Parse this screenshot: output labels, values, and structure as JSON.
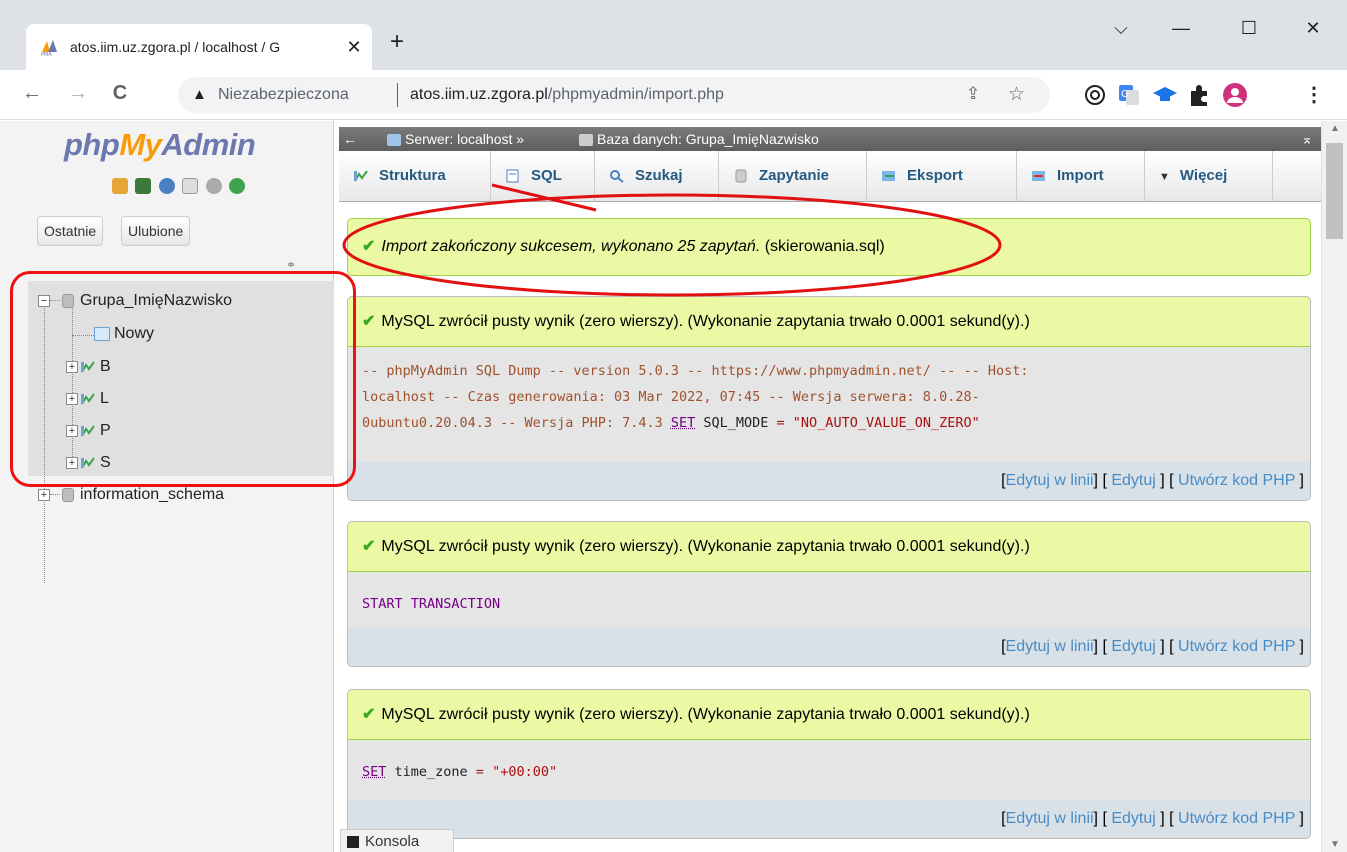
{
  "browser": {
    "tab_title": "atos.iim.uz.zgora.pl / localhost / G",
    "tab_close": "✕",
    "new_tab": "+",
    "window_controls": {
      "dropdown": "⌵",
      "minimize": "—",
      "maximize": "☐",
      "close": "✕"
    },
    "nav": {
      "back": "←",
      "forward": "→",
      "reload": "C"
    },
    "omnibox": {
      "security_icon": "▲",
      "security_label": "Niezabezpieczona",
      "host": "atos.iim.uz.zgora.pl",
      "path": "/phpmyadmin/import.php",
      "share": "⇪",
      "star": "☆"
    },
    "menu": "⋮"
  },
  "pma_nav": {
    "logo_php": "php",
    "logo_my": "My",
    "logo_admin": "Admin",
    "recent_button": "Ostatnie",
    "favorites_button": "Ulubione",
    "link_icon": "⚭",
    "tree": {
      "db_name": "Grupa_ImięNazwisko",
      "new_label": "Nowy",
      "tables": [
        "B",
        "L",
        "P",
        "S"
      ],
      "other_db": "information_schema",
      "expanded_sign": "−",
      "collapsed_sign": "+"
    }
  },
  "main": {
    "back_arrow": "←",
    "breadcrumb_server": "Serwer: localhost »",
    "breadcrumb_db": "Baza danych: Grupa_ImięNazwisko",
    "collapse_icon": "⌅",
    "tabs": [
      {
        "label": "Struktura"
      },
      {
        "label": "SQL"
      },
      {
        "label": "Szukaj"
      },
      {
        "label": "Zapytanie"
      },
      {
        "label": "Eksport"
      },
      {
        "label": "Import"
      },
      {
        "label": "Więcej"
      }
    ],
    "more_arrow": "▼",
    "success_message": {
      "check": "✔",
      "italic": "Import zakończony sukcesem, wykonano 25 zapytań.",
      "file": "(skierowania.sql)"
    },
    "results": [
      {
        "status": "MySQL zwrócił pusty wynik (zero wierszy). (Wykonanie zapytania trwało 0.0001 sekund(y).)",
        "code_line1": "-- phpMyAdmin SQL Dump -- version 5.0.3 -- https://www.phpmyadmin.net/ -- -- Host:",
        "code_line2": "localhost -- Czas generowania: 03 Mar 2022, 07:45 -- Wersja serwera: 8.0.28-",
        "code_line3_a": "0ubuntu0.20.04.3 -- Wersja PHP: 7.4.3 ",
        "code_line3_kw": "SET",
        "code_line3_b": " SQL_MODE ",
        "code_line3_op": "=",
        "code_line3_str": " \"NO_AUTO_VALUE_ON_ZERO\""
      },
      {
        "status": "MySQL zwrócił pusty wynik (zero wierszy). (Wykonanie zapytania trwało 0.0001 sekund(y).)",
        "code": "START TRANSACTION"
      },
      {
        "status": "MySQL zwrócił pusty wynik (zero wierszy). (Wykonanie zapytania trwało 0.0001 sekund(y).)",
        "code_kw": "SET",
        "code_plain": " time_zone ",
        "code_op": "=",
        "code_str": " \"+00:00\""
      }
    ],
    "actions": {
      "open": "[",
      "inline_edit": "Edytuj w linii",
      "mid1": "] [ ",
      "edit": "Edytuj",
      "mid2": " ] [ ",
      "create_php": "Utwórz kod PHP",
      "close": " ]"
    },
    "console_label": "Konsola"
  },
  "colors": {
    "accent_red": "#e11111",
    "success_bg": "#ebf8a4",
    "link_blue": "#4a8bc4",
    "pma_blue": "#235a81"
  }
}
